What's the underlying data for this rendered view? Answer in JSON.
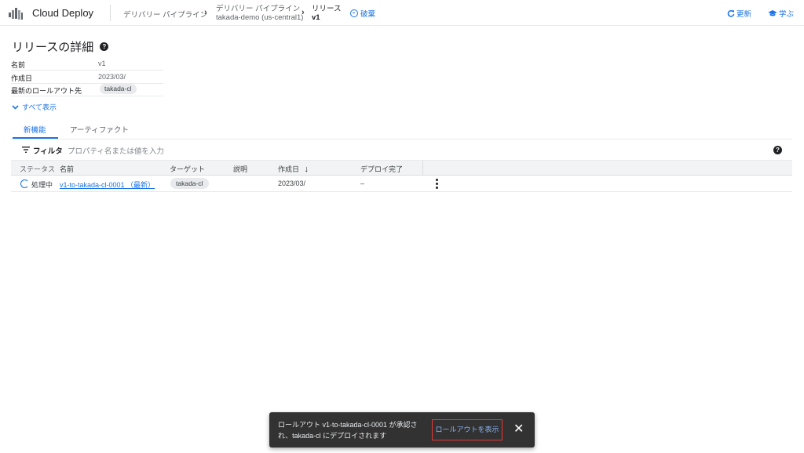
{
  "header": {
    "product_name": "Cloud Deploy",
    "breadcrumb": {
      "pipelines": "デリバリー パイプライン",
      "pipeline_type": "デリバリー パイプライン",
      "pipeline_name": "takada-demo (us-central1)",
      "release_type": "リリース",
      "release_name": "v1"
    },
    "discard_label": "破棄",
    "refresh_label": "更新",
    "learn_label": "学ぶ",
    "accent_color": "#1a73e8"
  },
  "details": {
    "title": "リリースの詳細",
    "rows": [
      {
        "key": "名前",
        "value": "v1"
      },
      {
        "key": "作成日",
        "value": "2023/03/"
      },
      {
        "key": "最新のロールアウト先",
        "value": "takada-cl"
      }
    ],
    "show_all": "すべて表示"
  },
  "tabs": [
    {
      "label": "新機能",
      "active": true
    },
    {
      "label": "アーティファクト",
      "active": false
    }
  ],
  "filter": {
    "label": "フィルタ",
    "placeholder": "プロパティ名または値を入力"
  },
  "table": {
    "columns": [
      "ステータス",
      "名前",
      "ターゲット",
      "説明",
      "作成日",
      "デプロイ完了"
    ],
    "sort_indicator": "↓",
    "rows": [
      {
        "status": "処理中",
        "name": "v1-to-takada-cl-0001 （最新）",
        "target": "takada-cl",
        "description": "",
        "created": "2023/03/",
        "deploy_complete": "–"
      }
    ]
  },
  "snackbar": {
    "message": "ロールアウト v1-to-takada-cl-0001 が承認され、takada-cl にデプロイされます",
    "action_label": "ロールアウトを表示",
    "close_symbol": "✕"
  }
}
